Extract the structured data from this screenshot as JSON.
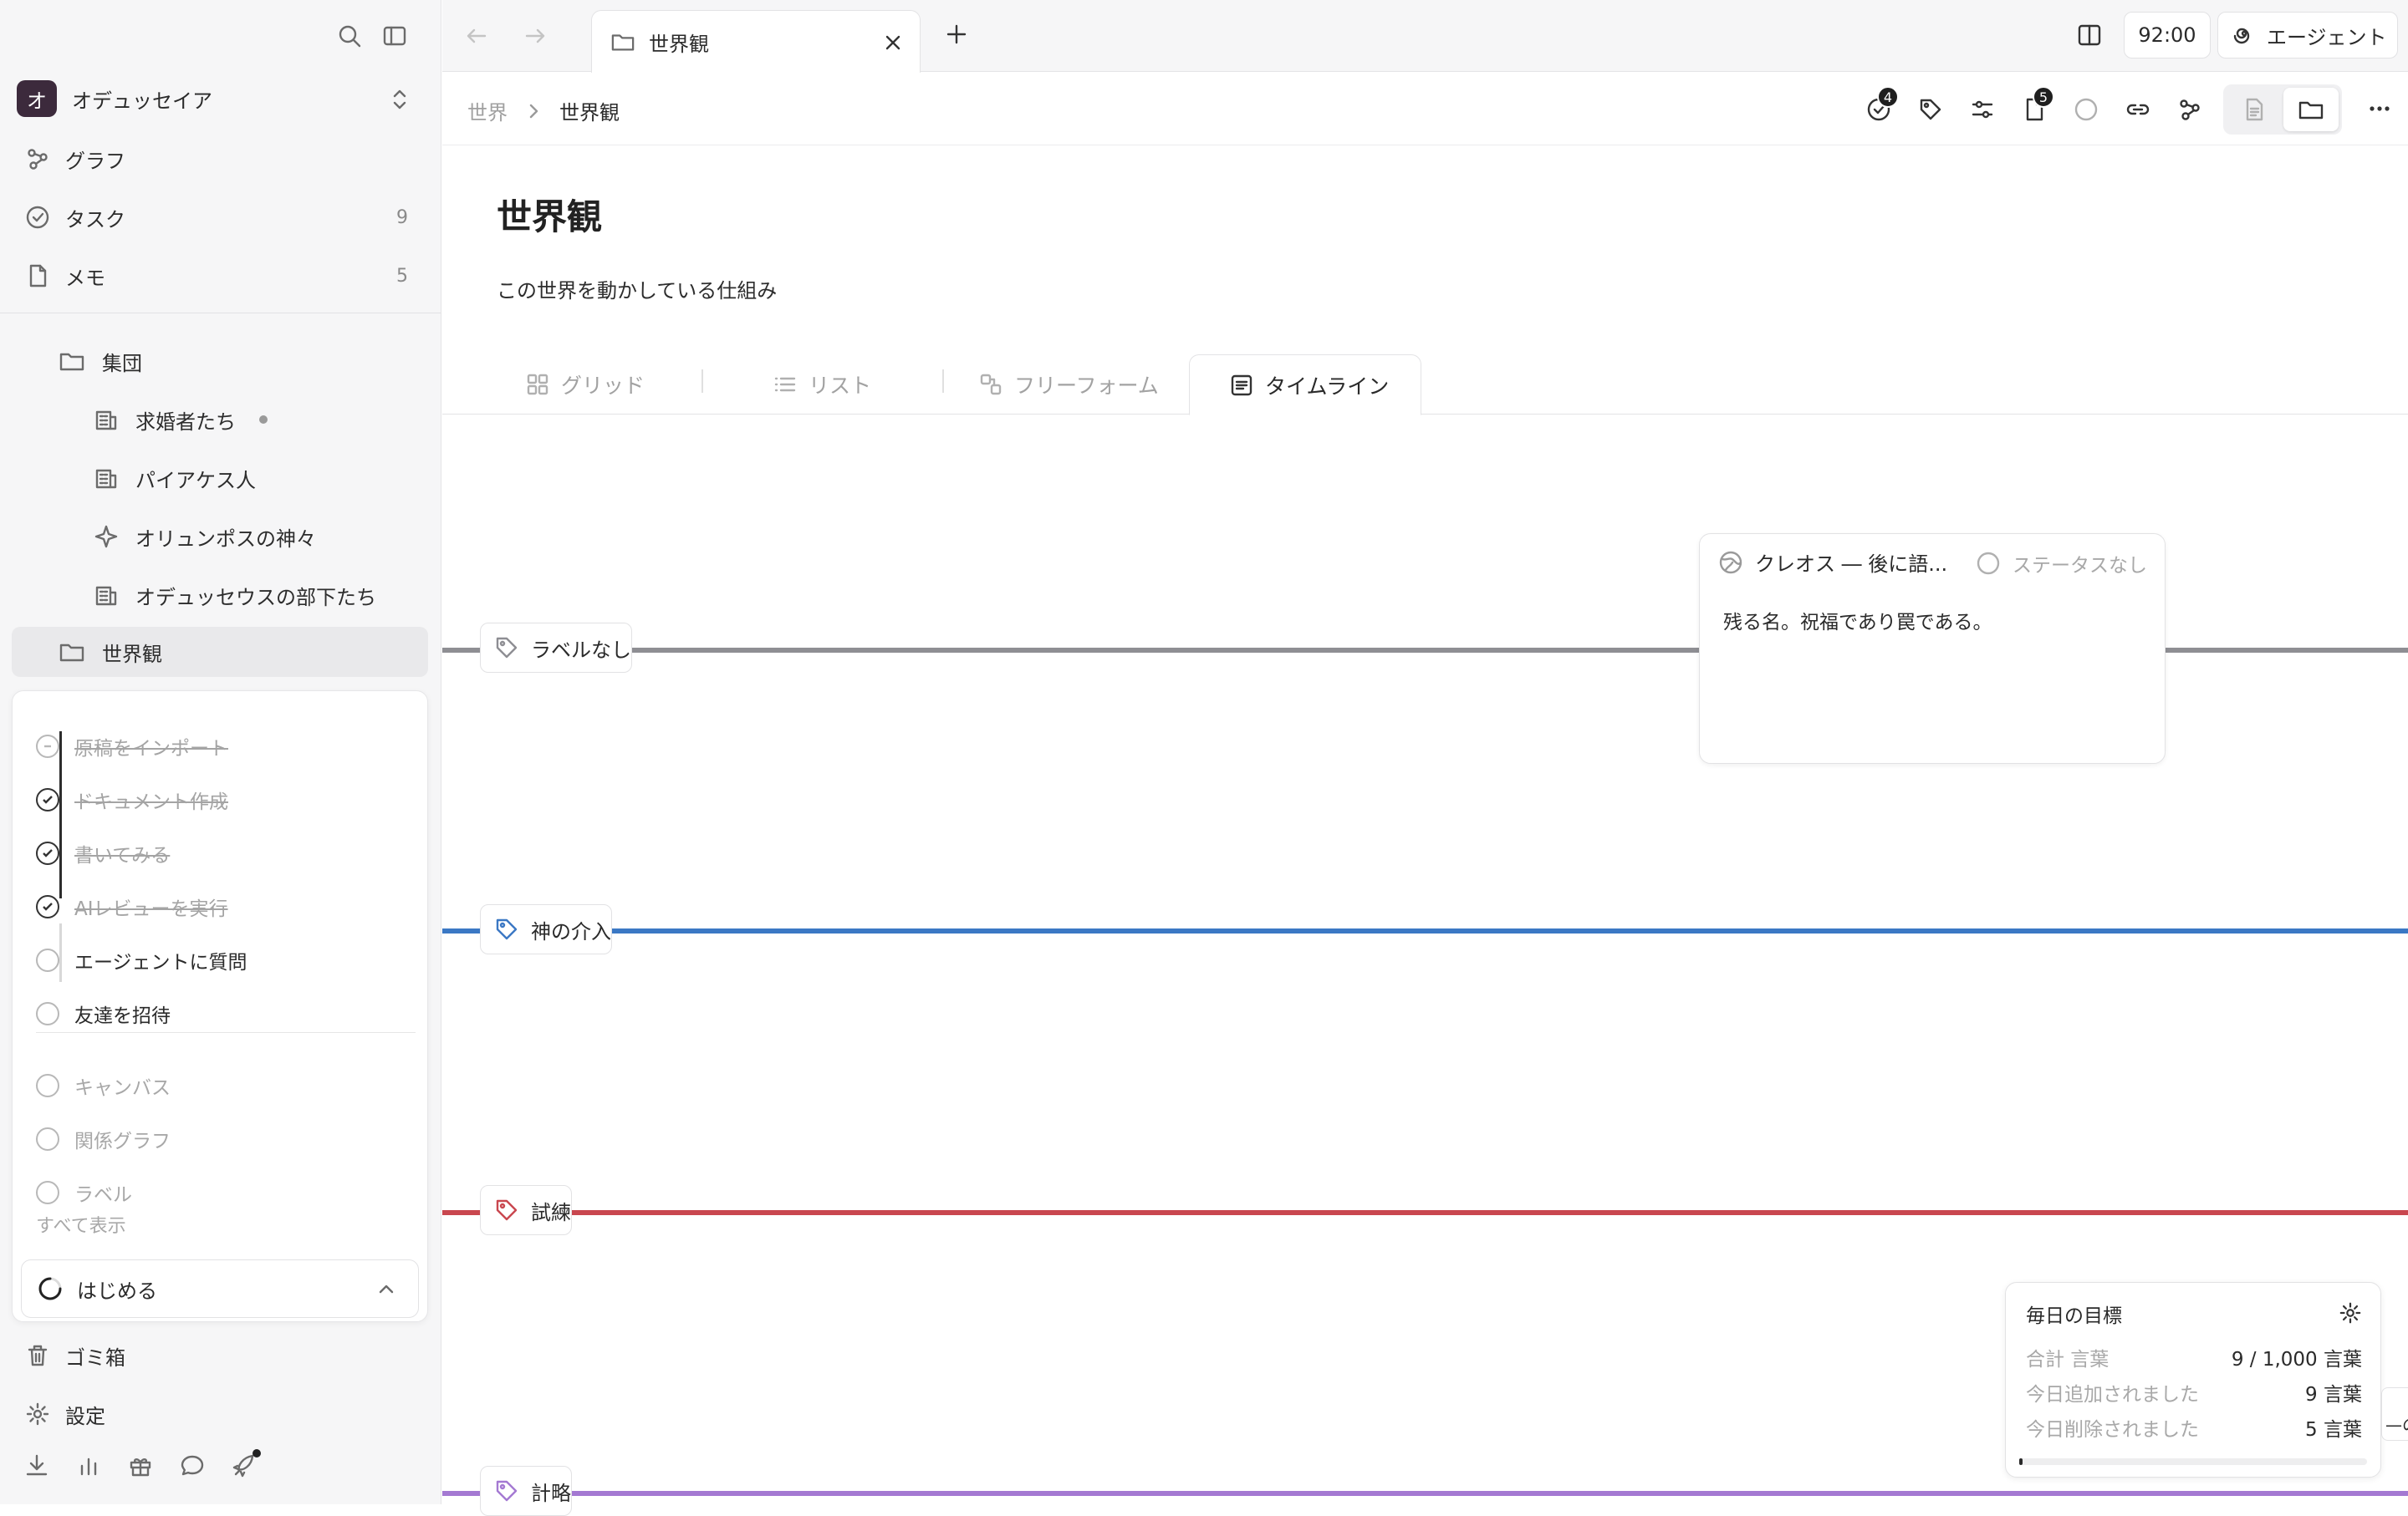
{
  "workspace": {
    "initial": "オ",
    "name": "オデュッセイア"
  },
  "nav": [
    {
      "label": "グラフ",
      "count": ""
    },
    {
      "label": "タスク",
      "count": "9"
    },
    {
      "label": "メモ",
      "count": "5"
    }
  ],
  "tree": [
    {
      "label": "集団"
    },
    {
      "label": "求婚者たち"
    },
    {
      "label": "パイアケス人"
    },
    {
      "label": "オリュンポスの神々"
    },
    {
      "label": "オデュッセウスの部下たち"
    },
    {
      "label": "世界観"
    }
  ],
  "onboarding": {
    "steps": [
      {
        "label": "原稿をインポート",
        "state": "done"
      },
      {
        "label": "ドキュメント作成",
        "state": "done"
      },
      {
        "label": "書いてみる",
        "state": "done"
      },
      {
        "label": "AIレビューを実行",
        "state": "done"
      },
      {
        "label": "エージェントに質問",
        "state": "todo"
      },
      {
        "label": "友達を招待",
        "state": "todo"
      }
    ],
    "extra": [
      {
        "label": "キャンバス"
      },
      {
        "label": "関係グラフ"
      },
      {
        "label": "ラベル"
      }
    ],
    "show_all": "すべて表示",
    "start_label": "はじめる"
  },
  "bottom": {
    "trash": "ゴミ箱",
    "settings": "設定"
  },
  "tabbar": {
    "tab_title": "世界観",
    "timer": "92:00",
    "agent": "エージェント"
  },
  "breadcrumb": {
    "parent": "世界",
    "current": "世界観"
  },
  "toolbar": {
    "tasks_badge": "4",
    "docs_badge": "5"
  },
  "page": {
    "title": "世界観",
    "subtitle": "この世界を動かしている仕組み"
  },
  "views": [
    {
      "label": "グリッド"
    },
    {
      "label": "リスト"
    },
    {
      "label": "フリーフォーム"
    },
    {
      "label": "タイムライン",
      "active": true
    }
  ],
  "lanes": [
    {
      "label": "ラベルなし",
      "color": "#8e8e93"
    },
    {
      "label": "神の介入",
      "color": "#3b78c4"
    },
    {
      "label": "試練",
      "color": "#c9474f"
    },
    {
      "label": "計略",
      "color": "#a479d2"
    }
  ],
  "card": {
    "title": "クレオス ― 後に語...",
    "status": "ステータスなし",
    "body": "残る名。祝福であり罠である。"
  },
  "goal": {
    "title": "毎日の目標",
    "rows": [
      {
        "key": "合計 言葉",
        "value": "9 / 1,000 言葉"
      },
      {
        "key": "今日追加されました",
        "value": "9 言葉"
      },
      {
        "key": "今日削除されました",
        "value": "5 言葉"
      }
    ],
    "progress": 0.009
  },
  "peek_text": "—の("
}
